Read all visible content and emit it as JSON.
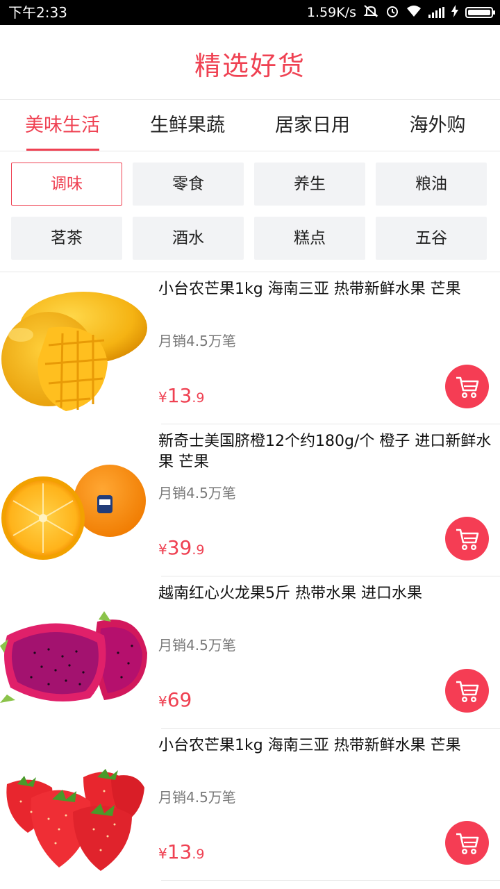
{
  "status_bar": {
    "time": "下午2:33",
    "speed": "1.59K/s",
    "icons": [
      "mute-icon",
      "alarm-icon",
      "wifi-icon",
      "signal-icon",
      "charging-icon",
      "battery-icon"
    ]
  },
  "title": "精选好货",
  "tabs": [
    {
      "label": "美味生活",
      "active": true
    },
    {
      "label": "生鲜果蔬",
      "active": false
    },
    {
      "label": "居家日用",
      "active": false
    },
    {
      "label": "海外购",
      "active": false
    }
  ],
  "subcategories": [
    {
      "label": "调味",
      "active": true
    },
    {
      "label": "零食",
      "active": false
    },
    {
      "label": "养生",
      "active": false
    },
    {
      "label": "粮油",
      "active": false
    },
    {
      "label": "茗茶",
      "active": false
    },
    {
      "label": "酒水",
      "active": false
    },
    {
      "label": "糕点",
      "active": false
    },
    {
      "label": "五谷",
      "active": false
    }
  ],
  "products": [
    {
      "title": "小台农芒果1kg 海南三亚 热带新鲜水果 芒果",
      "sales": "月销4.5万笔",
      "currency": "¥",
      "price_int": "13",
      "price_dec": ".9",
      "image": "mango"
    },
    {
      "title": "新奇士美国脐橙12个约180g/个 橙子 进口新鲜水果 芒果",
      "sales": "月销4.5万笔",
      "currency": "¥",
      "price_int": "39",
      "price_dec": ".9",
      "image": "orange"
    },
    {
      "title": "越南红心火龙果5斤 热带水果 进口水果",
      "sales": "月销4.5万笔",
      "currency": "¥",
      "price_int": "69",
      "price_dec": "",
      "image": "dragonfruit"
    },
    {
      "title": "小台农芒果1kg 海南三亚 热带新鲜水果 芒果",
      "sales": "月销4.5万笔",
      "currency": "¥",
      "price_int": "13",
      "price_dec": ".9",
      "image": "strawberry"
    }
  ],
  "colors": {
    "accent": "#ef4152",
    "cart": "#f53d54",
    "chip_bg": "#f2f3f5"
  }
}
